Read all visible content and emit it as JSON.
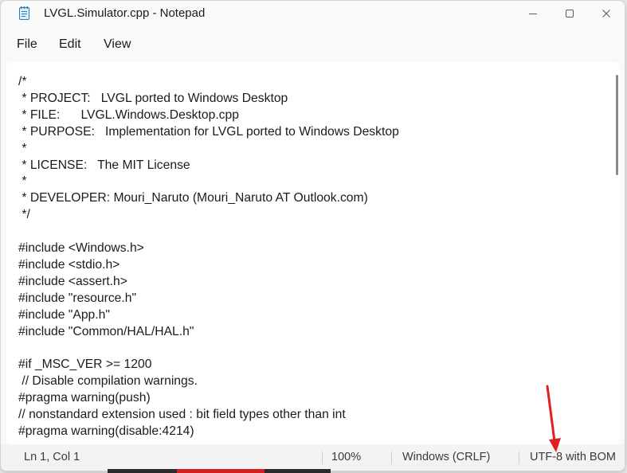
{
  "window": {
    "title": "LVGL.Simulator.cpp - Notepad"
  },
  "menu": {
    "file": "File",
    "edit": "Edit",
    "view": "View"
  },
  "editor": {
    "lines": [
      "/*",
      " * PROJECT:   LVGL ported to Windows Desktop",
      " * FILE:      LVGL.Windows.Desktop.cpp",
      " * PURPOSE:   Implementation for LVGL ported to Windows Desktop",
      " *",
      " * LICENSE:   The MIT License",
      " *",
      " * DEVELOPER: Mouri_Naruto (Mouri_Naruto AT Outlook.com)",
      " */",
      "",
      "#include <Windows.h>",
      "#include <stdio.h>",
      "#include <assert.h>",
      "#include \"resource.h\"",
      "#include \"App.h\"",
      "#include \"Common/HAL/HAL.h\"",
      "",
      "#if _MSC_VER >= 1200",
      " // Disable compilation warnings.",
      "#pragma warning(push)",
      "// nonstandard extension used : bit field types other than int",
      "#pragma warning(disable:4214)"
    ]
  },
  "status": {
    "position": "Ln 1, Col 1",
    "zoom": "100%",
    "line_ending": "Windows (CRLF)",
    "encoding": "UTF-8 with BOM"
  },
  "icons": {
    "app": "notepad-icon",
    "minimize": "minimize-icon",
    "maximize": "maximize-icon",
    "close": "close-icon",
    "settings": "gear-icon",
    "annotation": "red-arrow-icon"
  },
  "colors": {
    "annotation": "#e02020",
    "text": "#1b1b1b"
  }
}
